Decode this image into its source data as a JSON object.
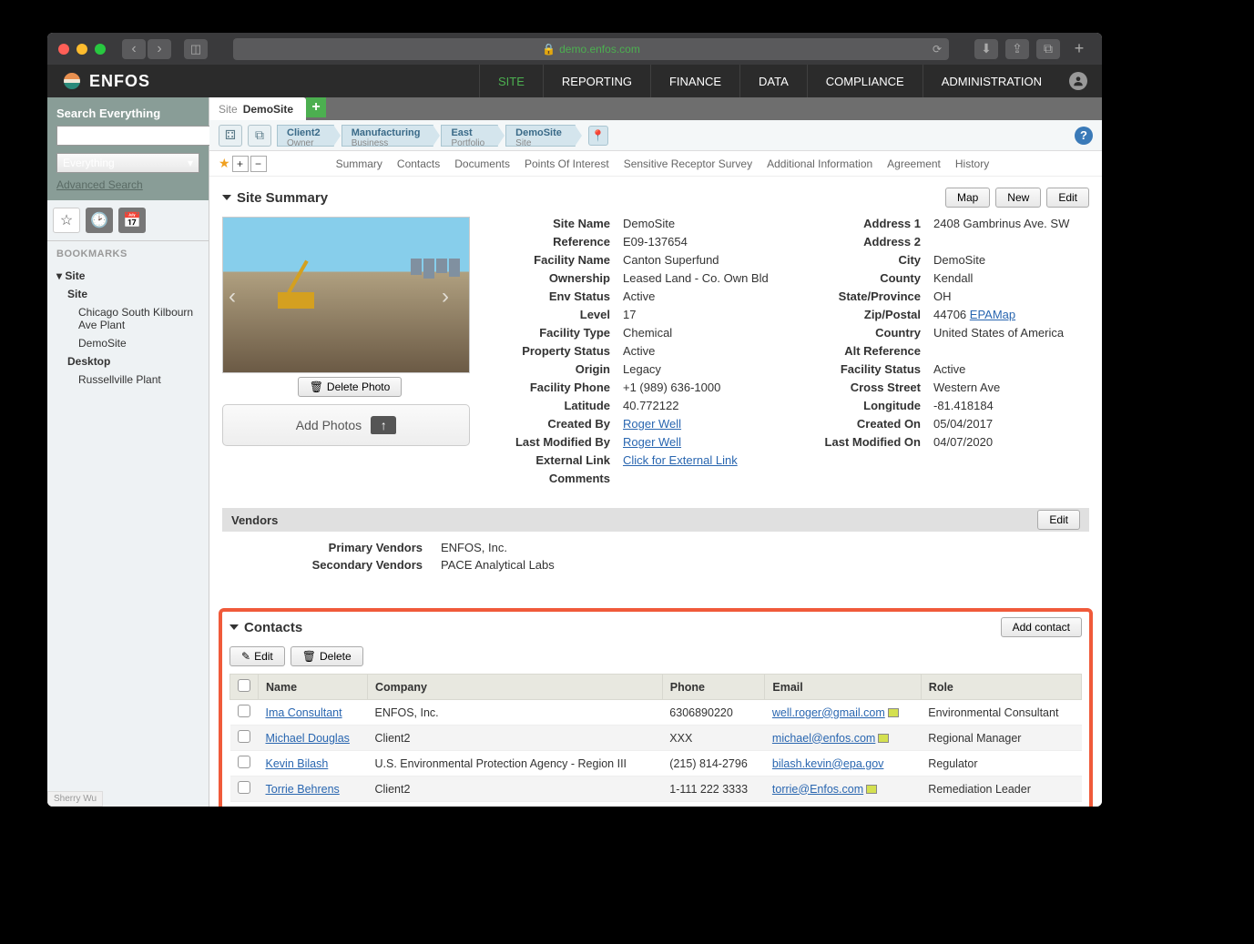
{
  "browser": {
    "url": "demo.enfos.com"
  },
  "app": {
    "name": "ENFOS",
    "nav": [
      "SITE",
      "REPORTING",
      "FINANCE",
      "DATA",
      "COMPLIANCE",
      "ADMINISTRATION"
    ],
    "active_nav": "SITE"
  },
  "search": {
    "title": "Search Everything",
    "select": "Everything",
    "advanced": "Advanced Search"
  },
  "bookmarks": {
    "label": "BOOKMARKS",
    "tree": [
      {
        "label": "Site",
        "bold": true,
        "indent": 0
      },
      {
        "label": "Site",
        "bold": true,
        "indent": 1
      },
      {
        "label": "Chicago South Kilbourn Ave Plant",
        "bold": false,
        "indent": 2
      },
      {
        "label": "DemoSite",
        "bold": false,
        "indent": 2
      },
      {
        "label": "Desktop",
        "bold": true,
        "indent": 1
      },
      {
        "label": "Russellville Plant",
        "bold": false,
        "indent": 2
      }
    ]
  },
  "tab": {
    "type": "Site",
    "name": "DemoSite"
  },
  "breadcrumbs": [
    {
      "title": "Client2",
      "sub": "Owner"
    },
    {
      "title": "Manufacturing",
      "sub": "Business"
    },
    {
      "title": "East",
      "sub": "Portfolio"
    },
    {
      "title": "DemoSite",
      "sub": "Site"
    }
  ],
  "subnav": [
    "Summary",
    "Contacts",
    "Documents",
    "Points Of Interest",
    "Sensitive Receptor Survey",
    "Additional Information",
    "Agreement",
    "History"
  ],
  "summary": {
    "title": "Site Summary",
    "buttons": {
      "map": "Map",
      "new": "New",
      "edit": "Edit"
    },
    "delete_photo": "Delete Photo",
    "add_photos": "Add Photos",
    "left": [
      {
        "label": "Site Name",
        "value": "DemoSite"
      },
      {
        "label": "Reference",
        "value": "E09-137654"
      },
      {
        "label": "Facility Name",
        "value": "Canton Superfund"
      },
      {
        "label": "Ownership",
        "value": "Leased Land - Co. Own Bld"
      },
      {
        "label": "Env Status",
        "value": "Active"
      },
      {
        "label": "Level",
        "value": "17"
      },
      {
        "label": "Facility Type",
        "value": "Chemical"
      },
      {
        "label": "Property Status",
        "value": "Active"
      },
      {
        "label": "Origin",
        "value": "Legacy"
      },
      {
        "label": "Facility Phone",
        "value": "+1 (989) 636-1000"
      },
      {
        "label": "Latitude",
        "value": "40.772122"
      },
      {
        "label": "Created By",
        "value": "Roger Well",
        "link": true
      },
      {
        "label": "Last Modified By",
        "value": "Roger Well",
        "link": true
      },
      {
        "label": "External Link",
        "value": "Click for External Link",
        "link": true
      },
      {
        "label": "Comments",
        "value": ""
      }
    ],
    "right": [
      {
        "label": "Address 1",
        "value": "2408 Gambrinus Ave. SW"
      },
      {
        "label": "Address 2",
        "value": ""
      },
      {
        "label": "City",
        "value": "DemoSite"
      },
      {
        "label": "County",
        "value": "Kendall"
      },
      {
        "label": "State/Province",
        "value": "OH"
      },
      {
        "label": "Zip/Postal",
        "value": "44706",
        "extra_link": "EPAMap"
      },
      {
        "label": "Country",
        "value": "United States of America"
      },
      {
        "label": "Alt Reference",
        "value": ""
      },
      {
        "label": "Facility Status",
        "value": "Active"
      },
      {
        "label": "Cross Street",
        "value": "Western Ave"
      },
      {
        "label": "Longitude",
        "value": "-81.418184"
      },
      {
        "label": "Created On",
        "value": "05/04/2017"
      },
      {
        "label": "Last Modified On",
        "value": "04/07/2020"
      }
    ]
  },
  "vendors": {
    "title": "Vendors",
    "edit": "Edit",
    "rows": [
      {
        "label": "Primary Vendors",
        "value": "ENFOS, Inc."
      },
      {
        "label": "Secondary Vendors",
        "value": "PACE Analytical Labs"
      }
    ]
  },
  "contacts": {
    "title": "Contacts",
    "add": "Add contact",
    "edit": "Edit",
    "delete": "Delete",
    "columns": [
      "",
      "Name",
      "Company",
      "Phone",
      "Email",
      "Role"
    ],
    "rows": [
      {
        "name": "Ima Consultant",
        "company": "ENFOS, Inc.",
        "phone": "6306890220",
        "email": "well.roger@gmail.com",
        "email_icon": true,
        "role": "Environmental Consultant"
      },
      {
        "name": "Michael Douglas",
        "company": "Client2",
        "phone": "XXX",
        "email": "michael@enfos.com",
        "email_icon": true,
        "role": "Regional Manager"
      },
      {
        "name": "Kevin Bilash",
        "company": "U.S. Environmental Protection Agency - Region III",
        "phone": "(215) 814-2796",
        "email": "bilash.kevin@epa.gov",
        "email_icon": false,
        "role": "Regulator"
      },
      {
        "name": "Torrie Behrens",
        "company": "Client2",
        "phone": "1-111 222 3333",
        "email": "torrie@Enfos.com",
        "email_icon": true,
        "role": "Remediation Leader"
      }
    ]
  },
  "footer_user": "Sherry Wu"
}
